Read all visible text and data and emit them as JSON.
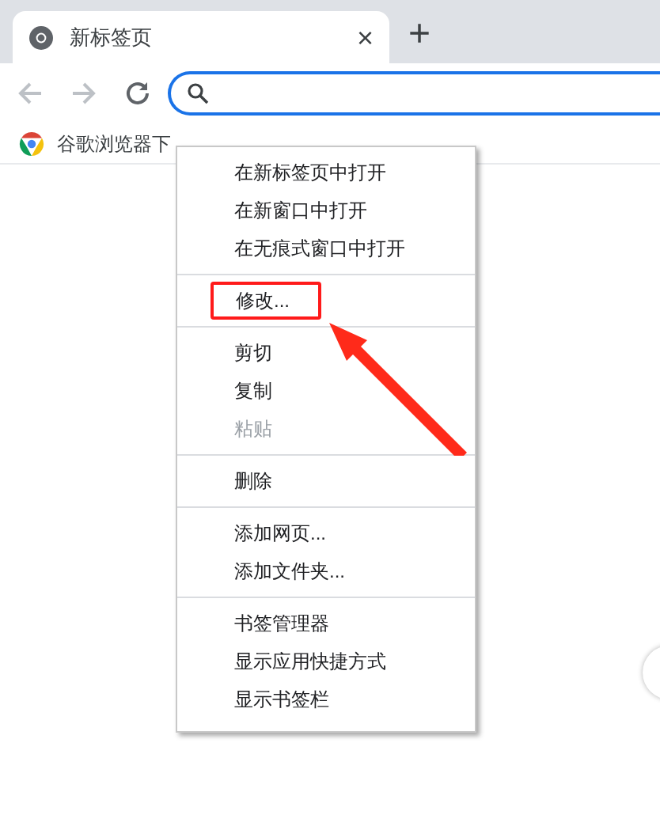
{
  "tab": {
    "title": "新标签页",
    "close": "×",
    "new_tab": "+"
  },
  "bookmarks": [
    {
      "label": "谷歌浏览器下"
    }
  ],
  "context_menu": {
    "groups": [
      {
        "items": [
          {
            "label": "在新标签页中打开",
            "disabled": false,
            "highlighted": false
          },
          {
            "label": "在新窗口中打开",
            "disabled": false,
            "highlighted": false
          },
          {
            "label": "在无痕式窗口中打开",
            "disabled": false,
            "highlighted": false
          }
        ]
      },
      {
        "items": [
          {
            "label": "修改...",
            "disabled": false,
            "highlighted": true
          }
        ]
      },
      {
        "items": [
          {
            "label": "剪切",
            "disabled": false,
            "highlighted": false
          },
          {
            "label": "复制",
            "disabled": false,
            "highlighted": false
          },
          {
            "label": "粘贴",
            "disabled": true,
            "highlighted": false
          }
        ]
      },
      {
        "items": [
          {
            "label": "删除",
            "disabled": false,
            "highlighted": false
          }
        ]
      },
      {
        "items": [
          {
            "label": "添加网页...",
            "disabled": false,
            "highlighted": false
          },
          {
            "label": "添加文件夹...",
            "disabled": false,
            "highlighted": false
          }
        ]
      },
      {
        "items": [
          {
            "label": "书签管理器",
            "disabled": false,
            "highlighted": false
          },
          {
            "label": "显示应用快捷方式",
            "disabled": false,
            "highlighted": false
          },
          {
            "label": "显示书签栏",
            "disabled": false,
            "highlighted": false
          }
        ]
      }
    ]
  }
}
